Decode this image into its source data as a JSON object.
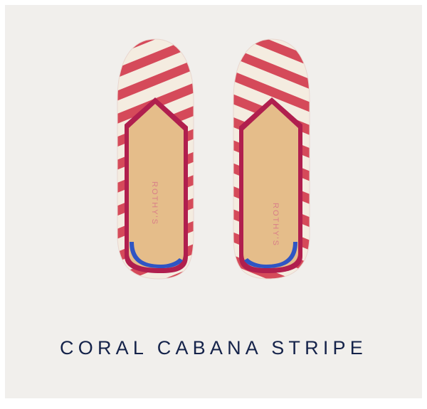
{
  "product": {
    "name": "CORAL CABANA STRIPE",
    "brand_mark": "ROTHY'S",
    "colors": {
      "background": "#f1efec",
      "stripe_red": "#d54a5a",
      "stripe_cream": "#f4ece0",
      "trim_magenta": "#b01f4e",
      "insole_tan": "#e5bd8a",
      "heel_blue": "#2f55c4",
      "caption_navy": "#15234a"
    }
  }
}
